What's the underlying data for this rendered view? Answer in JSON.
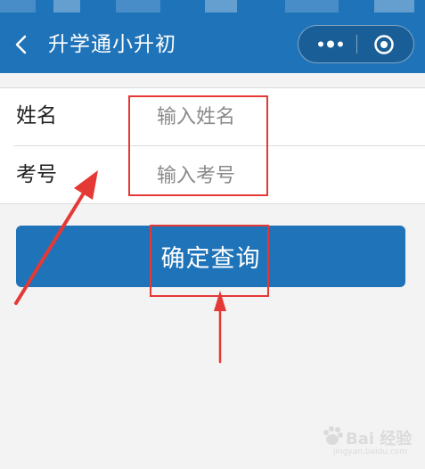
{
  "header": {
    "title": "升学通小升初",
    "back_icon": "chevron-left-icon",
    "menu_icon": "more-dots-icon",
    "close_icon": "target-circle-icon"
  },
  "form": {
    "name_label": "姓名",
    "name_placeholder": "输入姓名",
    "exam_label": "考号",
    "exam_placeholder": "输入考号"
  },
  "submit_label": "确定查询",
  "watermark": {
    "brand": "Bai 经验",
    "url": "jingyan.baidu.com"
  },
  "colors": {
    "primary": "#1f73b8",
    "annotation": "#e53935",
    "background": "#f3f3f3"
  }
}
